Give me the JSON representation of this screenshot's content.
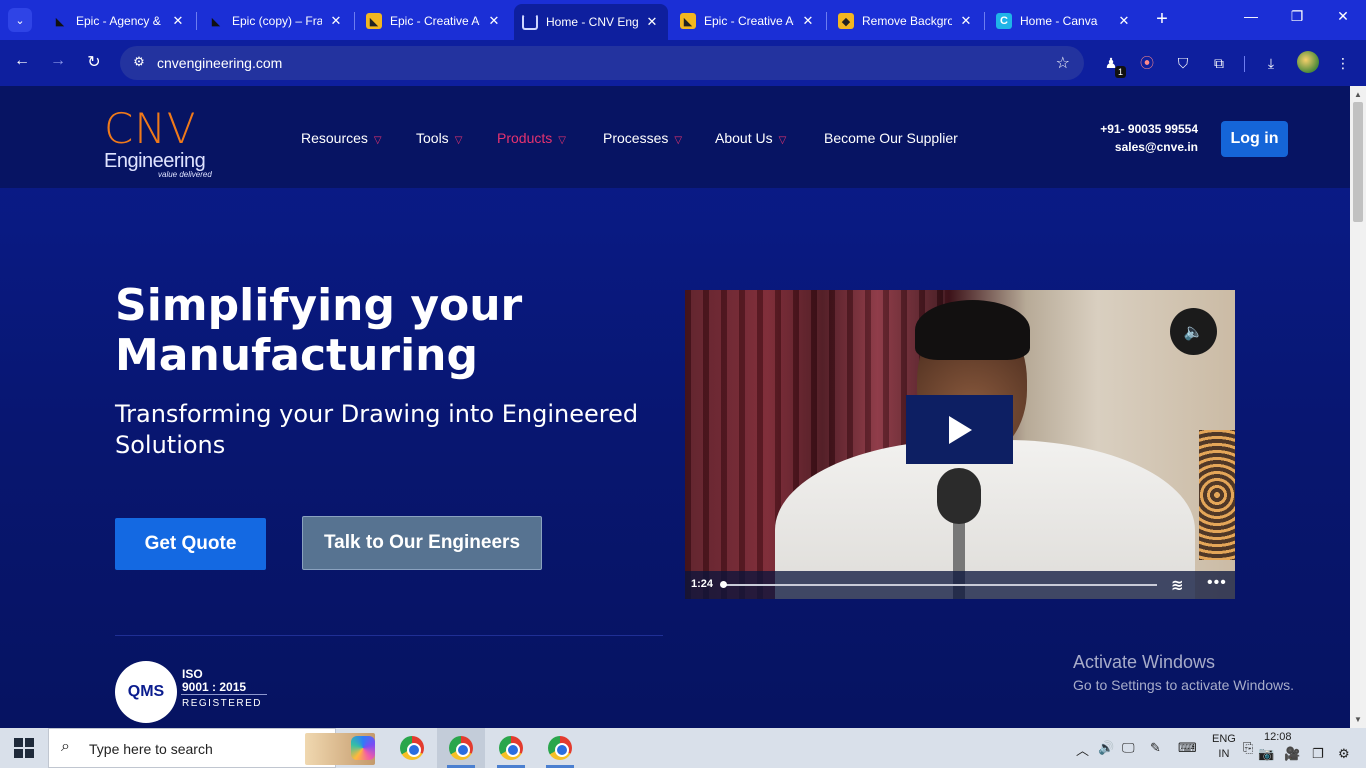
{
  "browser": {
    "tabs": [
      {
        "title": "Epic - Agency & Portfolio",
        "favicon": "framer-icon"
      },
      {
        "title": "Epic (copy) – Framer",
        "favicon": "framer-icon"
      },
      {
        "title": "Epic - Creative Agency",
        "favicon": "framer-yellow-icon"
      },
      {
        "title": "Home - CNV Engineering",
        "favicon": "loading-icon",
        "active": true
      },
      {
        "title": "Epic - Creative Agency",
        "favicon": "framer-yellow-icon"
      },
      {
        "title": "Remove Background",
        "favicon": "remove-bg-icon"
      },
      {
        "title": "Home - Canva",
        "favicon": "canva-icon"
      }
    ],
    "address": "cnvengineering.com",
    "extension_badge": "1"
  },
  "site": {
    "logo": {
      "main": "CNV",
      "sub": "Engineering",
      "tagline": "value delivered"
    },
    "nav": [
      {
        "label": "Resources",
        "has_menu": true
      },
      {
        "label": "Tools",
        "has_menu": true
      },
      {
        "label": "Products",
        "has_menu": true,
        "active": true
      },
      {
        "label": "Processes",
        "has_menu": true
      },
      {
        "label": "About Us",
        "has_menu": true
      },
      {
        "label": "Become Our Supplier",
        "has_menu": false
      }
    ],
    "phone": "+91- 90035 99554",
    "email": "sales@cnve.in",
    "login_label": "Log in",
    "hero": {
      "title_line1": "Simplifying your",
      "title_line2": "Manufacturing",
      "subtitle": "Transforming your Drawing into Engineered Solutions",
      "primary_cta": "Get Quote",
      "secondary_cta": "Talk to Our Engineers"
    },
    "certification": {
      "badge": "QMS",
      "iso": "ISO",
      "standard": "9001 : 2015",
      "status": "REGISTERED"
    },
    "video": {
      "time": "1:24",
      "progress": 0.0
    }
  },
  "watermark": {
    "title": "Activate Windows",
    "subtitle": "Go to Settings to activate Windows."
  },
  "taskbar": {
    "search_placeholder": "Type here to search",
    "lang_line1": "ENG",
    "lang_line2": "IN",
    "time": "12:08"
  },
  "colors": {
    "brand_orange": "#f07a1a",
    "accent_pink": "#e5326f",
    "primary_blue": "#1469e2",
    "page_bg": "#0a1c8e"
  }
}
